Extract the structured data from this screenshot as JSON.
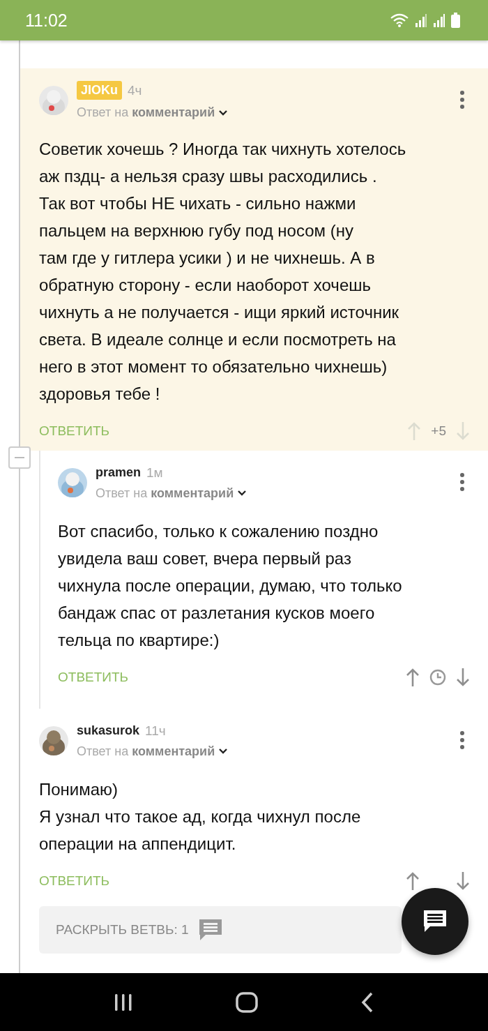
{
  "status_bar": {
    "time": "11:02"
  },
  "comments": [
    {
      "author": "JIOKu",
      "author_badge": true,
      "time": "4ч",
      "reply_label": "Ответ на",
      "reply_target": "комментарий",
      "text": "Советик хочешь ? Иногда так чихнуть хотелось\nаж пздц- а нельзя сразу швы расходились .\nТак вот чтобы НЕ чихать - сильно нажми\nпальцем на верхнюю губу под носом (ну\nтам где у гитлера усики ) и не чихнешь. А в\nобратную сторону - если наоборот хочешь\nчихнуть а не получается - ищи яркий источник\nсвета. В идеале солнце и если посмотреть на\nнего в этот момент то обязательно чихнешь)\nздоровья тебе !",
      "reply_button": "ОТВЕТИТЬ",
      "kind": "rating",
      "rating": "+5",
      "voting_enabled": false,
      "highlighted": true,
      "nested": false
    },
    {
      "author": "pramen",
      "author_badge": false,
      "time": "1м",
      "reply_label": "Ответ на",
      "reply_target": "комментарий",
      "text": "Вот спасибо, только к сожалению поздно\nувидела ваш совет, вчера первый раз\nчихнула после операции, думаю, что только\nбандаж спас от разлетания кусков моего\nтельца по квартире:)",
      "reply_button": "ОТВЕТИТЬ",
      "kind": "clock",
      "voting_enabled": true,
      "highlighted": false,
      "nested": true
    },
    {
      "author": "sukasurok",
      "author_badge": false,
      "time": "11ч",
      "reply_label": "Ответ на",
      "reply_target": "комментарий",
      "text": "Понимаю)\nЯ узнал что такое ад, когда чихнул после\nоперации на аппендицит.",
      "reply_button": "ОТВЕТИТЬ",
      "kind": "arrows",
      "voting_enabled": true,
      "highlighted": false,
      "nested": false,
      "expand_branch": "РАСКРЫТЬ ВЕТВЬ: 1"
    }
  ]
}
